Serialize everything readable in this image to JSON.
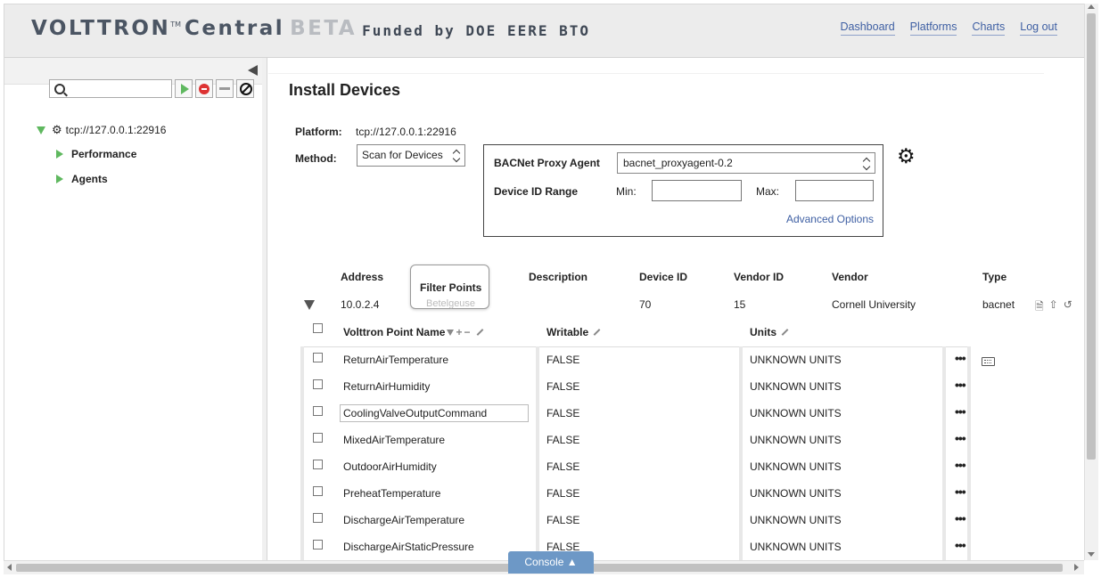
{
  "header": {
    "brand": "VOLTTRON",
    "tm": "TM",
    "central": "Central",
    "beta": "BETA",
    "funded": "Funded by DOE EERE BTO",
    "nav": [
      "Dashboard",
      "Platforms",
      "Charts",
      "Log out"
    ]
  },
  "sidebar": {
    "search_placeholder": "",
    "tree_root": "tcp://127.0.0.1:22916",
    "children": [
      "Performance",
      "Agents"
    ]
  },
  "page": {
    "title": "Install Devices",
    "platform_label": "Platform:",
    "platform_value": "tcp://127.0.0.1:22916",
    "method_label": "Method:",
    "method_value": "Scan for Devices",
    "proxy_label": "BACNet Proxy Agent",
    "proxy_value": "bacnet_proxyagent-0.2",
    "range_label": "Device ID Range",
    "min_label": "Min:",
    "max_label": "Max:",
    "advanced_link": "Advanced Options"
  },
  "device_table": {
    "headers": [
      "Address",
      "Description",
      "Device ID",
      "Vendor ID",
      "Vendor",
      "Type"
    ],
    "row": {
      "address": "10.0.2.4",
      "name_hidden": "Betelgeuse",
      "device_id": "70",
      "vendor_id": "15",
      "vendor": "Cornell University",
      "type": "bacnet"
    },
    "tooltip": "Filter Points"
  },
  "points_grid": {
    "headers": [
      "Volttron Point Name",
      "Writable",
      "Units"
    ],
    "rows": [
      {
        "name": "ReturnAirTemperature",
        "writable": "FALSE",
        "units": "UNKNOWN UNITS"
      },
      {
        "name": "ReturnAirHumidity",
        "writable": "FALSE",
        "units": "UNKNOWN UNITS"
      },
      {
        "name": "CoolingValveOutputCommand",
        "writable": "FALSE",
        "units": "UNKNOWN UNITS"
      },
      {
        "name": "MixedAirTemperature",
        "writable": "FALSE",
        "units": "UNKNOWN UNITS"
      },
      {
        "name": "OutdoorAirHumidity",
        "writable": "FALSE",
        "units": "UNKNOWN UNITS"
      },
      {
        "name": "PreheatTemperature",
        "writable": "FALSE",
        "units": "UNKNOWN UNITS"
      },
      {
        "name": "DischargeAirTemperature",
        "writable": "FALSE",
        "units": "UNKNOWN UNITS"
      },
      {
        "name": "DischargeAirStaticPressure",
        "writable": "FALSE",
        "units": "UNKNOWN UNITS"
      }
    ],
    "more_glyph": "•••"
  },
  "console": {
    "label": "Console ▲"
  },
  "colors": {
    "accent": "#5fb85f",
    "link": "#3e5fa3",
    "console": "#6d98c6"
  }
}
